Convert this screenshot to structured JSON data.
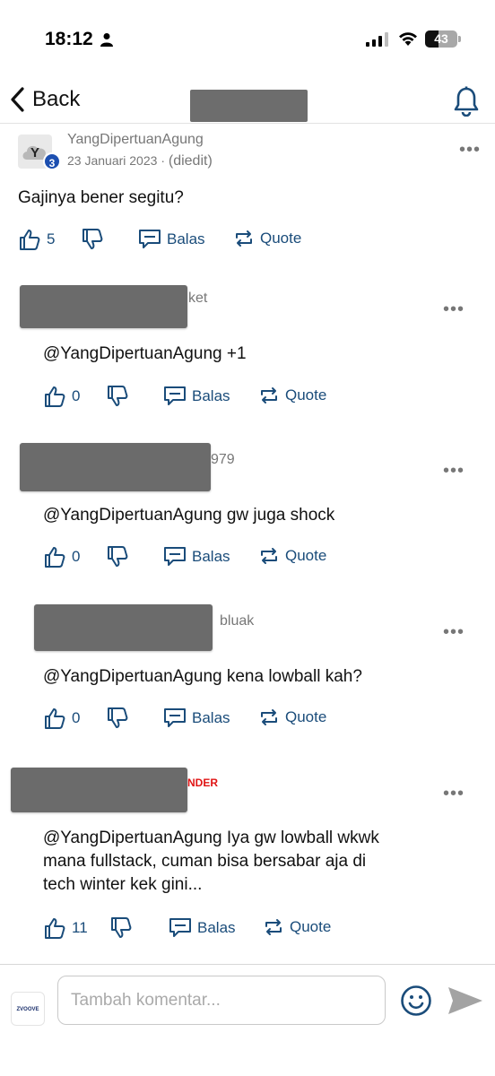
{
  "status_bar": {
    "time": "18:12",
    "battery": "43"
  },
  "nav": {
    "back_label": "Back"
  },
  "comments": [
    {
      "author": "YangDipertuanAgung",
      "avatar_letter": "Y",
      "badge": "3",
      "date": "23 Januari 2023",
      "separator": "·",
      "edited": "(diedit)",
      "text": "Gajinya bener segitu?",
      "likes": "5",
      "reply_label": "Balas",
      "quote_label": "Quote"
    },
    {
      "author_suffix": "ket",
      "text": "@YangDipertuanAgung +1",
      "likes": "0",
      "reply_label": "Balas",
      "quote_label": "Quote"
    },
    {
      "author_suffix": "979",
      "text": "@YangDipertuanAgung gw juga shock",
      "likes": "0",
      "reply_label": "Balas",
      "quote_label": "Quote"
    },
    {
      "author_suffix": "bluak",
      "text": "@YangDipertuanAgung kena lowball kah?",
      "likes": "0",
      "reply_label": "Balas",
      "quote_label": "Quote"
    },
    {
      "author_suffix": "NDER",
      "text_lines": [
        "@YangDipertuanAgung Iya gw lowball wkwk",
        "mana fullstack, cuman bisa bersabar aja di",
        "tech winter kek gini..."
      ],
      "likes": "11",
      "reply_label": "Balas",
      "quote_label": "Quote"
    }
  ],
  "composer": {
    "logo_text": "ZVOOVE",
    "placeholder": "Tambah komentar..."
  },
  "colors": {
    "accent": "#1a4c7a",
    "badge": "#1c4fb0",
    "tag_red": "#e01414",
    "redaction": "#6b6b6b"
  },
  "icons": [
    "person-icon",
    "signal-icon",
    "wifi-icon",
    "battery-icon",
    "chevron-left-icon",
    "bell-icon",
    "more-icon",
    "thumbs-up-icon",
    "thumbs-down-icon",
    "reply-icon",
    "quote-icon",
    "emoji-icon",
    "send-icon"
  ]
}
